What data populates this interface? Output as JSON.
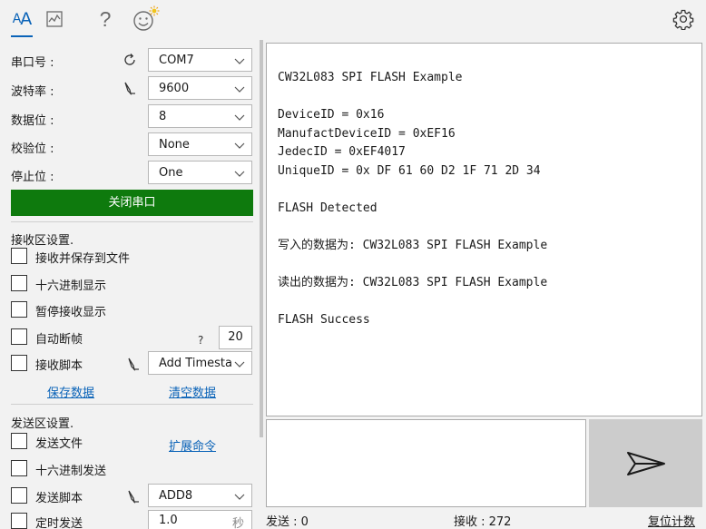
{
  "toolbar": {
    "font_label_big": "A",
    "font_label_small": "A",
    "help_label": "?",
    "icons": [
      "font-settings-icon",
      "chart-icon",
      "help-icon",
      "smiley-icon",
      "gear-icon"
    ]
  },
  "serial": {
    "port_label": "串口号 :",
    "port_value": "COM7",
    "baud_label": "波特率 :",
    "baud_value": "9600",
    "databits_label": "数据位 :",
    "databits_value": "8",
    "parity_label": "校验位 :",
    "parity_value": "None",
    "stopbits_label": "停止位 :",
    "stopbits_value": "One",
    "close_button": "关闭串口"
  },
  "receive_settings": {
    "title": "接收区设置.",
    "save_to_file": "接收并保存到文件",
    "hex_display": "十六进制显示",
    "pause_display": "暂停接收显示",
    "auto_frame": "自动断帧",
    "auto_frame_hint": "?",
    "auto_frame_value": "20",
    "recv_script": "接收脚本",
    "recv_script_value": "Add Timesta",
    "save_data": "保存数据",
    "clear_data": "清空数据"
  },
  "send_settings": {
    "title": "发送区设置.",
    "send_file": "发送文件",
    "extend_cmd": "扩展命令",
    "hex_send": "十六进制发送",
    "send_script": "发送脚本",
    "send_script_value": "ADD8",
    "timed_send": "定时发送",
    "timed_value": "1.0",
    "timed_unit": "秒"
  },
  "receive_text": [
    "CW32L083 SPI FLASH Example",
    "",
    "DeviceID = 0x16",
    "ManufactDeviceID = 0xEF16",
    "JedecID = 0xEF4017",
    "UniqueID = 0x DF 61 60 D2 1F 71 2D 34",
    "",
    "FLASH Detected",
    "",
    "写入的数据为: CW32L083 SPI FLASH Example",
    "",
    "读出的数据为: CW32L083 SPI FLASH Example",
    "",
    "FLASH Success"
  ],
  "status": {
    "sent": "发送 : 0",
    "received": "接收 : 272",
    "reset": "复位计数"
  },
  "colors": {
    "accent": "#0a63b8",
    "close_button": "#0e7a0d",
    "send_button": "#cccccc"
  }
}
